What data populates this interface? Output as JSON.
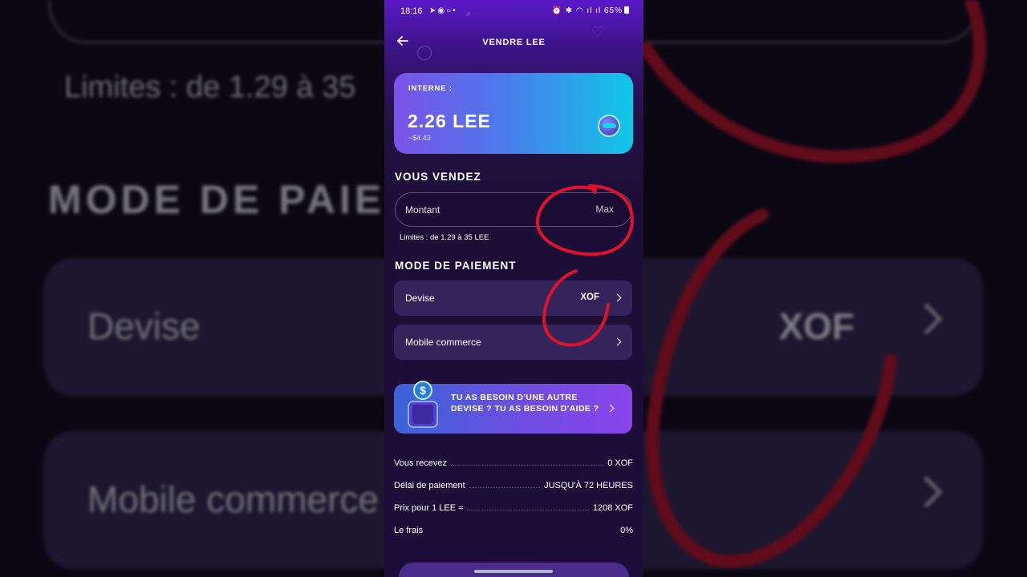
{
  "status_bar": {
    "time": "18:16",
    "battery": "65%"
  },
  "header": {
    "title": "VENDRE LEE"
  },
  "balance": {
    "label": "INTERNE :",
    "amount": "2.26 LEE",
    "usd": "~$4.43"
  },
  "sell": {
    "section_title": "VOUS VENDEZ",
    "amount_placeholder": "Montant",
    "max_label": "Max",
    "limits": "Limites : de 1.29 à 35 LEE"
  },
  "payment": {
    "section_title": "MODE DE PAIEMENT",
    "currency_label": "Devise",
    "currency_value": "XOF",
    "method_label": "Mobile commerce"
  },
  "help_banner": {
    "text": "TU AS BESOIN D'UNE AUTRE DEVISE ? TU AS BESOIN D'AIDE ?"
  },
  "summary": [
    {
      "label": "Vous recevez",
      "value": "0 XOF"
    },
    {
      "label": "Délai de paiement",
      "value": "JUSQU'À 72 HEURES"
    },
    {
      "label": "Prix pour 1 LEE ≈",
      "value": "1208 XOF"
    },
    {
      "label": "Le frais",
      "value": "0%"
    }
  ],
  "backdrop": {
    "limits": "Limites : de 1.29 à 35",
    "mode": "MODE DE PAIEMENT",
    "currency_label": "Devise",
    "currency_value": "XOF",
    "method_label": "Mobile commerce"
  },
  "colors": {
    "accent": "#6f4de0",
    "annotation": "#e0112b",
    "card_gradient_end": "#10c7e6"
  }
}
